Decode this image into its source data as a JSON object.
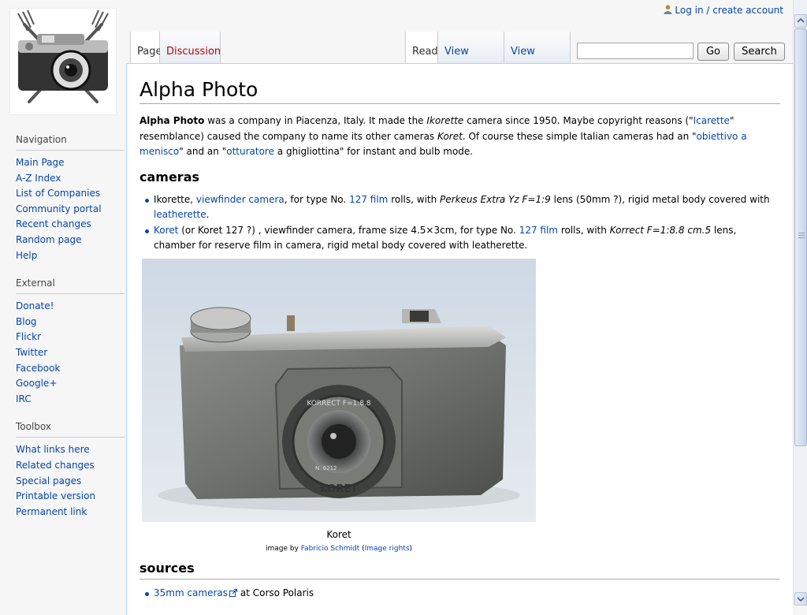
{
  "personal": {
    "login_label": "Log in / create account"
  },
  "tabs": {
    "page": "Page",
    "discussion": "Discussion",
    "read": "Read",
    "view_source": "View source",
    "view_history": "View history"
  },
  "search": {
    "go_label": "Go",
    "search_label": "Search",
    "value": ""
  },
  "sidebar": {
    "navigation": {
      "heading": "Navigation",
      "items": [
        "Main Page",
        "A-Z Index",
        "List of Companies",
        "Community portal",
        "Recent changes",
        "Random page",
        "Help"
      ]
    },
    "external": {
      "heading": "External",
      "items": [
        "Donate!",
        "Blog",
        "Flickr",
        "Twitter",
        "Facebook",
        "Google+",
        "IRC"
      ]
    },
    "toolbox": {
      "heading": "Toolbox",
      "items": [
        "What links here",
        "Related changes",
        "Special pages",
        "Printable version",
        "Permanent link"
      ]
    }
  },
  "article": {
    "title": "Alpha Photo",
    "intro": {
      "bold_name": "Alpha Photo",
      "t1": " was a company in Piacenza, Italy. It made the ",
      "ikorette": "Ikorette",
      "t2": " camera since 1950. Maybe copyright reasons (\"",
      "icarette_link": "Icarette",
      "t3": "\" resemblance) caused the company to name its other cameras ",
      "koret": "Koret",
      "t4": ". Of course these simple Italian cameras had an \"",
      "obiettivo_link": "obiettivo a menisco",
      "t5": "\" and an \"",
      "otturatore_link": "otturatore",
      "t6": " a ghigliottina\" for instant and bulb mode."
    },
    "cameras_heading": "cameras",
    "camera1": {
      "t1": "Ikorette, ",
      "viewfinder_link": "viewfinder camera",
      "t2": ", for type No. ",
      "film_link": "127 film",
      "t3": " rolls, with ",
      "lens": "Perkeus Extra Yz F=1:9",
      "t4": " lens (50mm ?), rigid metal body covered with ",
      "leatherette_link": "leatherette",
      "t5": "."
    },
    "camera2": {
      "koret_link": "Koret",
      "t1": " (or Koret 127 ?) , viewfinder camera, frame size 4.5×3cm, for type No. ",
      "film_link": "127 film",
      "t2": " rolls, with ",
      "lens": "Korrect F=1:8.8 cm.5",
      "t3": " lens, chamber for reserve film in camera, rigid metal body covered with leatherette."
    },
    "image": {
      "caption": "Koret",
      "credit_prefix": "image by ",
      "credit_author": "Fabricio Schmidt",
      "credit_open": " (",
      "credit_rights": "Image rights",
      "credit_close": ")",
      "lens_text": "KORRECT F=1:8.8",
      "lens_number": "N. 6212",
      "body_text": "KORET"
    },
    "sources_heading": "sources",
    "source1": {
      "link": "35mm cameras",
      "text": " at Corso Polaris"
    }
  }
}
